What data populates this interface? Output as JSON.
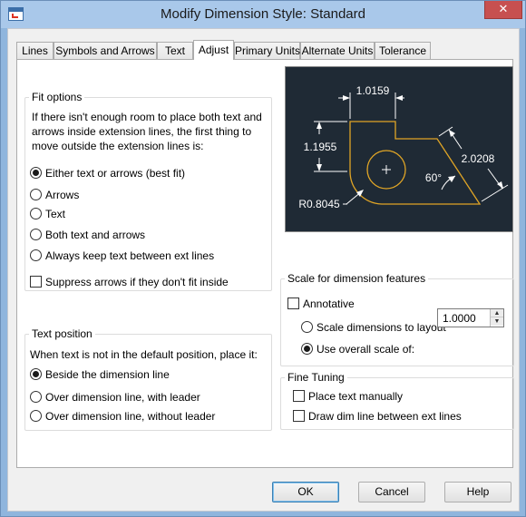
{
  "window": {
    "title": "Modify Dimension Style: Standard"
  },
  "tabs": [
    {
      "label": "Lines"
    },
    {
      "label": "Symbols and Arrows"
    },
    {
      "label": "Text"
    },
    {
      "label": "Adjust"
    },
    {
      "label": "Primary Units"
    },
    {
      "label": "Alternate Units"
    },
    {
      "label": "Tolerance"
    }
  ],
  "active_tab": "Adjust",
  "fit_options": {
    "title": "Fit options",
    "description": [
      "If there isn't enough room to place both text and",
      "arrows inside extension lines, the first thing to",
      "move outside the extension lines is:"
    ],
    "options": [
      {
        "label": "Either text or arrows (best fit)",
        "checked": true
      },
      {
        "label": "Arrows",
        "checked": false
      },
      {
        "label": "Text",
        "checked": false
      },
      {
        "label": "Both text and arrows",
        "checked": false
      },
      {
        "label": "Always keep text between ext lines",
        "checked": false
      }
    ],
    "suppress_label": "Suppress arrows if they don't fit inside"
  },
  "text_position": {
    "title": "Text position",
    "description": "When text is not in the default position, place it:",
    "options": [
      {
        "label": "Beside the dimension line",
        "checked": true
      },
      {
        "label": "Over dimension line, with leader",
        "checked": false
      },
      {
        "label": "Over dimension line, without leader",
        "checked": false
      }
    ]
  },
  "preview": {
    "dim_top": "1.0159",
    "dim_left": "1.1955",
    "dim_right": "2.0208",
    "dim_angle": "60°",
    "dim_radius": "R0.8045"
  },
  "scale": {
    "title": "Scale for dimension features",
    "annotative_label": "Annotative",
    "layout_label": "Scale dimensions to layout",
    "overall_label": "Use overall scale of:",
    "overall_value": "1.0000"
  },
  "fine_tuning": {
    "title": "Fine Tuning",
    "manual_label": "Place text manually",
    "dimline_label": "Draw dim line between ext lines"
  },
  "buttons": {
    "ok": "OK",
    "cancel": "Cancel",
    "help": "Help"
  },
  "colors": {
    "preview_bg": "#1f2a35",
    "outline": "#e0a526",
    "dim_lines": "#ffffff"
  }
}
